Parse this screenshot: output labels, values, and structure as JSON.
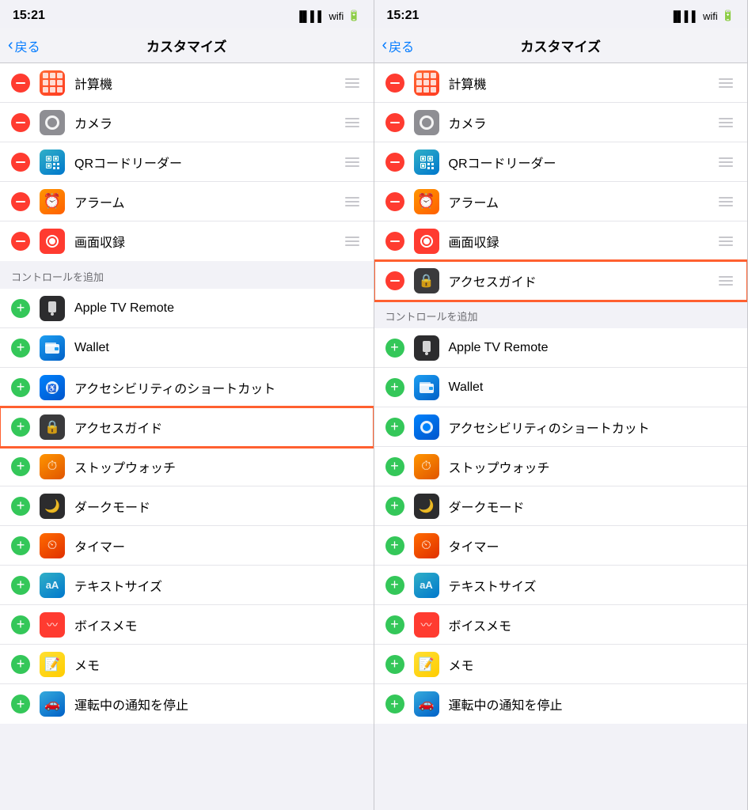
{
  "panel_left": {
    "status_time": "15:21",
    "nav_back": "戻る",
    "nav_title": "カスタマイズ",
    "active_items": [
      {
        "id": "calc",
        "label": "計算機",
        "icon": "calc"
      },
      {
        "id": "camera",
        "label": "カメラ",
        "icon": "camera"
      },
      {
        "id": "qr",
        "label": "QRコードリーダー",
        "icon": "qr"
      },
      {
        "id": "alarm",
        "label": "アラーム",
        "icon": "alarm"
      },
      {
        "id": "record",
        "label": "画面収録",
        "icon": "record"
      }
    ],
    "section_header": "コントロールを追加",
    "add_items": [
      {
        "id": "apptv",
        "label": "Apple TV Remote",
        "icon": "apptv"
      },
      {
        "id": "wallet",
        "label": "Wallet",
        "icon": "wallet"
      },
      {
        "id": "access_shortcut",
        "label": "アクセシビリティのショートカット",
        "icon": "access_shortcut"
      },
      {
        "id": "access_guide",
        "label": "アクセスガイド",
        "icon": "access_guide",
        "highlight": true
      },
      {
        "id": "stopwatch",
        "label": "ストップウォッチ",
        "icon": "stopwatch"
      },
      {
        "id": "dark",
        "label": "ダークモード",
        "icon": "dark"
      },
      {
        "id": "timer",
        "label": "タイマー",
        "icon": "timer"
      },
      {
        "id": "textsize",
        "label": "テキストサイズ",
        "icon": "textsize"
      },
      {
        "id": "voice",
        "label": "ボイスメモ",
        "icon": "voice"
      },
      {
        "id": "memo",
        "label": "メモ",
        "icon": "memo"
      },
      {
        "id": "drive",
        "label": "運転中の通知を停止",
        "icon": "drive"
      }
    ]
  },
  "panel_right": {
    "status_time": "15:21",
    "nav_back": "戻る",
    "nav_title": "カスタマイズ",
    "active_items": [
      {
        "id": "calc",
        "label": "計算機",
        "icon": "calc"
      },
      {
        "id": "camera",
        "label": "カメラ",
        "icon": "camera"
      },
      {
        "id": "qr",
        "label": "QRコードリーダー",
        "icon": "qr"
      },
      {
        "id": "alarm",
        "label": "アラーム",
        "icon": "alarm"
      },
      {
        "id": "record",
        "label": "画面収録",
        "icon": "record"
      },
      {
        "id": "access_guide",
        "label": "アクセスガイド",
        "icon": "access_guide",
        "highlight": true
      }
    ],
    "section_header": "コントロールを追加",
    "add_items": [
      {
        "id": "apptv",
        "label": "Apple TV Remote",
        "icon": "apptv"
      },
      {
        "id": "wallet",
        "label": "Wallet",
        "icon": "wallet"
      },
      {
        "id": "access_shortcut",
        "label": "アクセシビリティのショートカット",
        "icon": "access_shortcut"
      },
      {
        "id": "stopwatch",
        "label": "ストップウォッチ",
        "icon": "stopwatch"
      },
      {
        "id": "dark",
        "label": "ダークモード",
        "icon": "dark"
      },
      {
        "id": "timer",
        "label": "タイマー",
        "icon": "timer"
      },
      {
        "id": "textsize",
        "label": "テキストサイズ",
        "icon": "textsize"
      },
      {
        "id": "voice",
        "label": "ボイスメモ",
        "icon": "voice"
      },
      {
        "id": "memo",
        "label": "メモ",
        "icon": "memo"
      },
      {
        "id": "drive",
        "label": "運転中の通知を停止",
        "icon": "drive"
      }
    ]
  }
}
